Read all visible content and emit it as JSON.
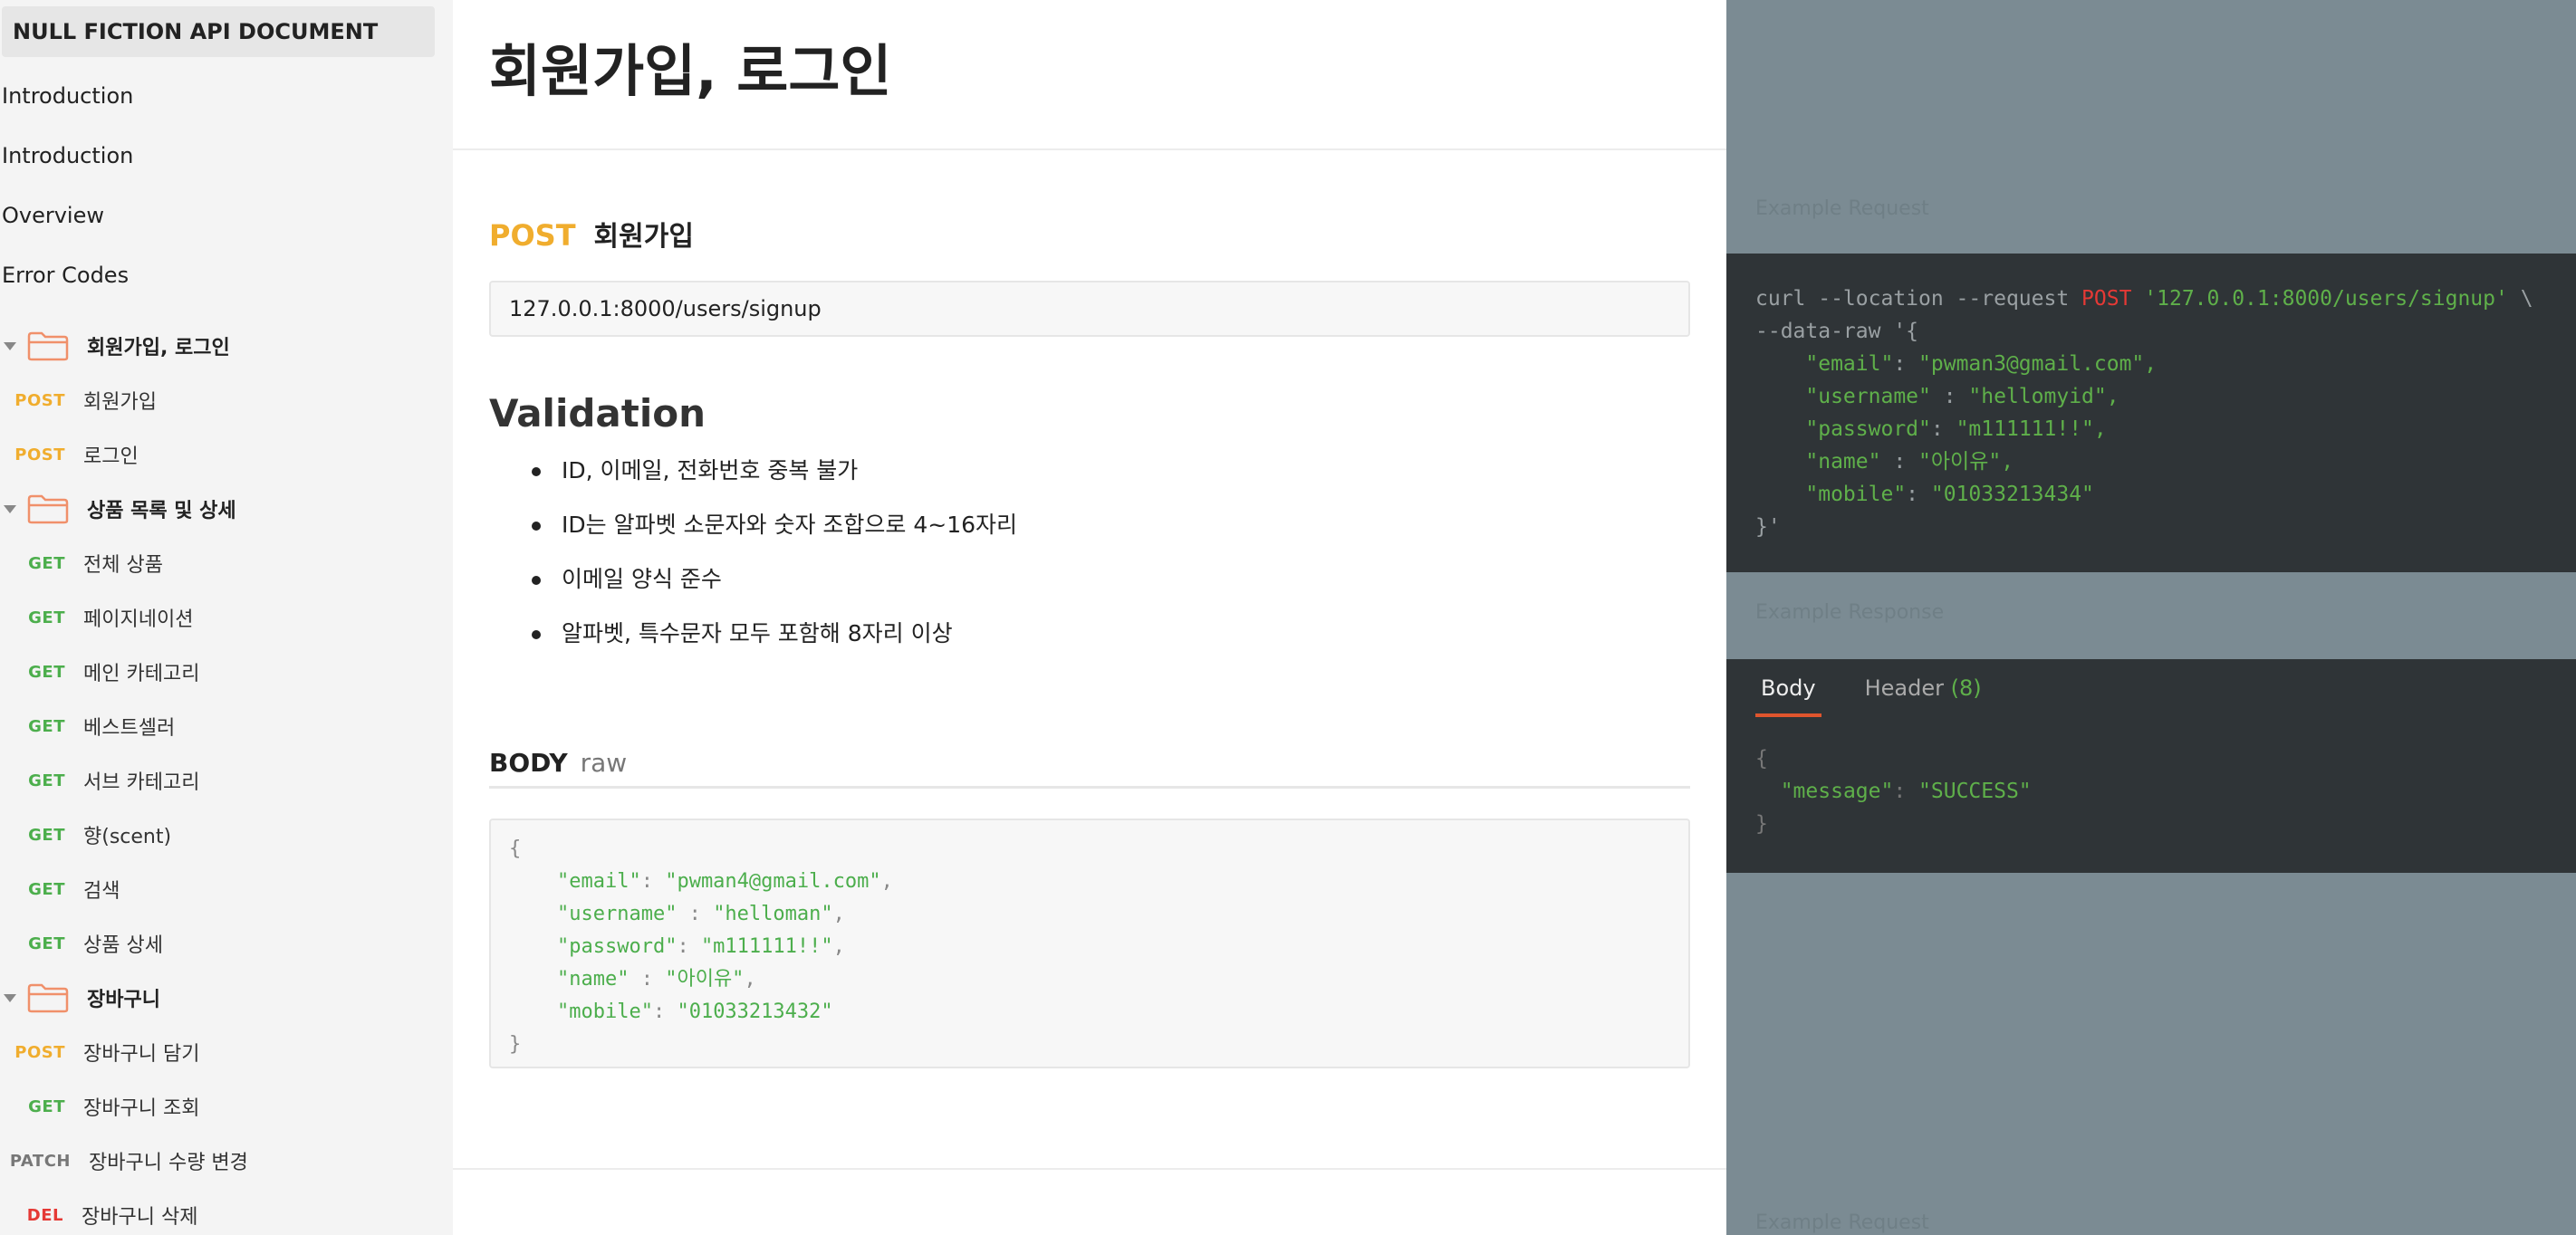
{
  "sidebar": {
    "title": "NULL FICTION API DOCUMENT",
    "links": [
      "Introduction",
      "Introduction",
      "Overview",
      "Error Codes"
    ],
    "folders": [
      {
        "label": "회원가입, 로그인"
      },
      {
        "label": "상품 목록 및 상세"
      },
      {
        "label": "장바구니"
      }
    ],
    "requests": [
      {
        "method": "POST",
        "label": "회원가입"
      },
      {
        "method": "POST",
        "label": "로그인"
      },
      {
        "method": "GET",
        "label": "전체 상품"
      },
      {
        "method": "GET",
        "label": "페이지네이션"
      },
      {
        "method": "GET",
        "label": "메인 카테고리"
      },
      {
        "method": "GET",
        "label": "베스트셀러"
      },
      {
        "method": "GET",
        "label": "서브 카테고리"
      },
      {
        "method": "GET",
        "label": "향(scent)"
      },
      {
        "method": "GET",
        "label": "검색"
      },
      {
        "method": "GET",
        "label": "상품 상세"
      },
      {
        "method": "POST",
        "label": "장바구니 담기"
      },
      {
        "method": "GET",
        "label": "장바구니 조회"
      },
      {
        "method": "PATCH",
        "label": "장바구니 수량 변경"
      },
      {
        "method": "DEL",
        "label": "장바구니 삭제"
      }
    ]
  },
  "main": {
    "page_title": "회원가입, 로그인",
    "endpoint": {
      "method": "POST",
      "name": "회원가입",
      "url": "127.0.0.1:8000/users/signup"
    },
    "validation": {
      "title": "Validation",
      "items": [
        "ID, 이메일, 전화번호 중복 불가",
        "ID는 알파벳 소문자와 숫자 조합으로 4~16자리",
        "이메일 양식 준수",
        "알파벳, 특수문자 모두 포함해 8자리 이상"
      ]
    },
    "body": {
      "label": "BODY",
      "mode": "raw",
      "fields": [
        {
          "key": "\"email\"",
          "sep": ": ",
          "value": "\"pwman4@gmail.com\""
        },
        {
          "key": "\"username\"",
          "sep": " : ",
          "value": "\"helloman\""
        },
        {
          "key": "\"password\"",
          "sep": ": ",
          "value": "\"m111111!!\""
        },
        {
          "key": "\"name\"",
          "sep": " : ",
          "value": "\"아이유\""
        },
        {
          "key": "\"mobile\"",
          "sep": ": ",
          "value": "\"01033213432\""
        }
      ]
    }
  },
  "right_panel": {
    "request_label": "Example Request",
    "curl": {
      "line1_pre": "curl --location --request ",
      "method": "POST",
      "url": "'127.0.0.1:8000/users/signup'",
      "line1_post": " \\",
      "line2": "--data-raw '{",
      "fields": [
        {
          "key": "\"email\"",
          "sep": ": ",
          "value": "\"pwman3@gmail.com\","
        },
        {
          "key": "\"username\"",
          "sep": " : ",
          "value": "\"hellomyid\","
        },
        {
          "key": "\"password\"",
          "sep": ": ",
          "value": "\"m111111!!\","
        },
        {
          "key": "\"name\"",
          "sep": " : ",
          "value": "\"아이유\","
        },
        {
          "key": "\"mobile\"",
          "sep": ": ",
          "value": "\"01033213434\""
        }
      ],
      "close": "}'"
    },
    "response_label": "Example Response",
    "tabs": {
      "body": "Body",
      "header": "Header",
      "header_count": "(8)"
    },
    "response": {
      "key": "\"message\"",
      "sep": ": ",
      "value": "\"SUCCESS\""
    },
    "bottom_label": "Example Request"
  },
  "colors": {
    "post": "#f0ad2e",
    "get": "#4cae4c",
    "patch": "#777777",
    "delete": "#e53935",
    "folder": "#f0906a",
    "code_bg": "#2f3437",
    "right_bg": "#7b8b93"
  },
  "icons": {
    "folder": "folder-icon",
    "caret": "caret-down-icon"
  }
}
